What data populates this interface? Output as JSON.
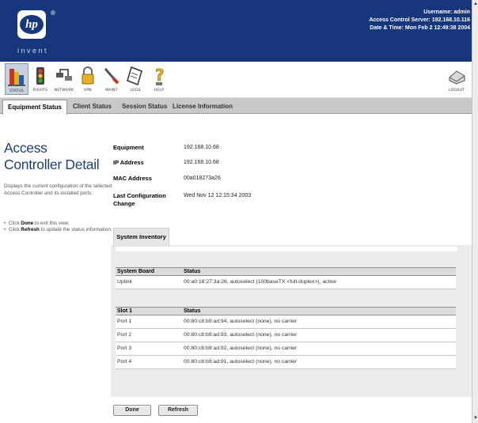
{
  "brand": {
    "logo_text": "hp",
    "tagline": "invent",
    "registered": "®"
  },
  "session": {
    "username_label": "Username:",
    "username": "admin",
    "server_label": "Access Control Server:",
    "server": "192.168.10.116",
    "datetime_label": "Date & Time:",
    "datetime": "Mon Feb 2 12:49:38 2004"
  },
  "toolbar": {
    "items": [
      {
        "label": "STATUS",
        "icon": "status-icon"
      },
      {
        "label": "RIGHTS",
        "icon": "rights-icon"
      },
      {
        "label": "NETWORK",
        "icon": "network-icon"
      },
      {
        "label": "VPN",
        "icon": "vpn-icon"
      },
      {
        "label": "MAINT",
        "icon": "maint-icon"
      },
      {
        "label": "LOGS",
        "icon": "logs-icon"
      },
      {
        "label": "HELP",
        "icon": "help-icon"
      }
    ],
    "logout_label": "LOGOUT"
  },
  "tabs": [
    {
      "label": "Equipment Status",
      "active": true
    },
    {
      "label": "Client Status",
      "active": false
    },
    {
      "label": "Session Status",
      "active": false
    },
    {
      "label": "License Information",
      "active": false
    }
  ],
  "page": {
    "title_line1": "Access",
    "title_line2": "Controller Detail",
    "description": "Displays the current configuration of the selected Access Controller and its installed ports.",
    "tip1_prefix": "Click ",
    "tip1_bold": "Done",
    "tip1_suffix": " to exit this view.",
    "tip2_prefix": "Click ",
    "tip2_bold": "Refresh",
    "tip2_suffix": " to update the status information."
  },
  "details": [
    {
      "label": "Equipment",
      "value": "192.168.10.68"
    },
    {
      "label": "IP Address",
      "value": "192.168.10.68"
    },
    {
      "label": "MAC Address",
      "value": "00a018273a26"
    },
    {
      "label": "Last Configuration Change",
      "value": "Wed Nov 12 12:15:34 2003"
    }
  ],
  "inventory": {
    "tab_label": "System Inventory",
    "board": {
      "headers": [
        "System Board",
        "Status"
      ],
      "rows": [
        [
          "Uplink",
          "00:a0:18:27:3a:26, autoselect (100baseTX <full-duplex>), active"
        ]
      ]
    },
    "slot": {
      "headers": [
        "Slot 1",
        "Status"
      ],
      "rows": [
        [
          "Port 1",
          "00:80:c8:b9:ad:94, autoselect (none), no carrier"
        ],
        [
          "Port 2",
          "00:80:c8:b9:ad:93, autoselect (none), no carrier"
        ],
        [
          "Port 3",
          "00:80:c8:b9:ad:92, autoselect (none), no carrier"
        ],
        [
          "Port 4",
          "00:80:c8:b9:ad:91, autoselect (none), no carrier"
        ]
      ]
    }
  },
  "buttons": {
    "done": "Done",
    "refresh": "Refresh"
  },
  "colors": {
    "header_bg": "#17367b",
    "title": "#24406e",
    "tab_bar": "#c9c9c9"
  }
}
